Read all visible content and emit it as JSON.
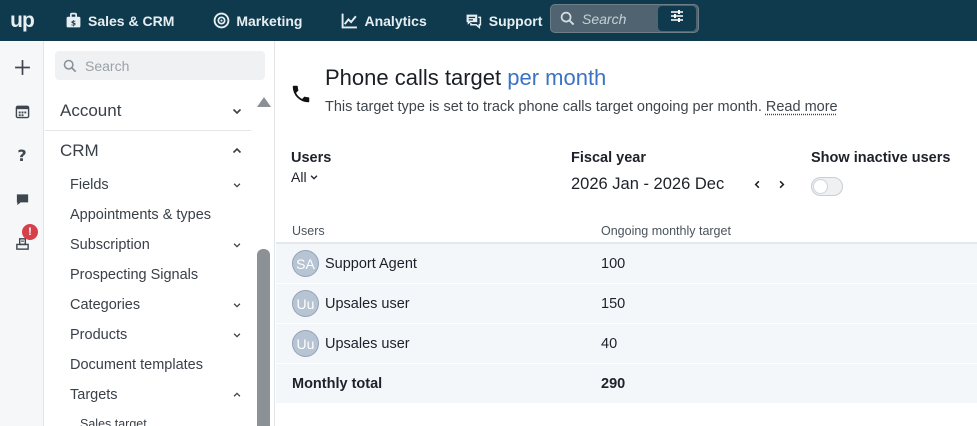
{
  "topnav": {
    "logo": "up",
    "items": [
      {
        "label": "Sales & CRM",
        "icon": "briefcase-icon"
      },
      {
        "label": "Marketing",
        "icon": "target-icon"
      },
      {
        "label": "Analytics",
        "icon": "chart-line-icon"
      },
      {
        "label": "Support",
        "icon": "chat-icon"
      }
    ],
    "search_placeholder": "Search"
  },
  "rail": {
    "icons": [
      "plus-icon",
      "calendar-icon",
      "help-icon",
      "chat-icon",
      "inbox-icon"
    ],
    "badge": "!"
  },
  "sidebar": {
    "search_placeholder": "Search",
    "sections": [
      {
        "label": "Account",
        "expanded": false
      },
      {
        "label": "CRM",
        "expanded": true
      }
    ],
    "crm_items": [
      {
        "label": "Fields",
        "chevron": "down"
      },
      {
        "label": "Appointments & types",
        "chevron": ""
      },
      {
        "label": "Subscription",
        "chevron": "down"
      },
      {
        "label": "Prospecting Signals",
        "chevron": ""
      },
      {
        "label": "Categories",
        "chevron": "down"
      },
      {
        "label": "Products",
        "chevron": "down"
      },
      {
        "label": "Document templates",
        "chevron": ""
      },
      {
        "label": "Targets",
        "chevron": "up"
      }
    ],
    "targets_sub": [
      {
        "label": "Sales target"
      }
    ]
  },
  "main": {
    "title_prefix": "Phone calls target",
    "title_accent": "per month",
    "subtitle": "This target type is set to track phone calls target ongoing per month.",
    "read_more": "Read more",
    "users_label": "Users",
    "users_value": "All",
    "fiscal_label": "Fiscal year",
    "fiscal_value": "2026 Jan - 2026 Dec",
    "inactive_label": "Show inactive users",
    "table": {
      "col_users": "Users",
      "col_target": "Ongoing monthly target",
      "rows": [
        {
          "initials": "SA",
          "name": "Support Agent",
          "value": "100"
        },
        {
          "initials": "Uu",
          "name": "Upsales user",
          "value": "150"
        },
        {
          "initials": "Uu",
          "name": "Upsales user",
          "value": "40"
        }
      ],
      "total_label": "Monthly total",
      "total_value": "290"
    }
  },
  "colors": {
    "topbar": "#0f3a4d",
    "accent": "#3b73c2",
    "row_bg": "#f4f7fa",
    "badge": "#d6404a"
  }
}
